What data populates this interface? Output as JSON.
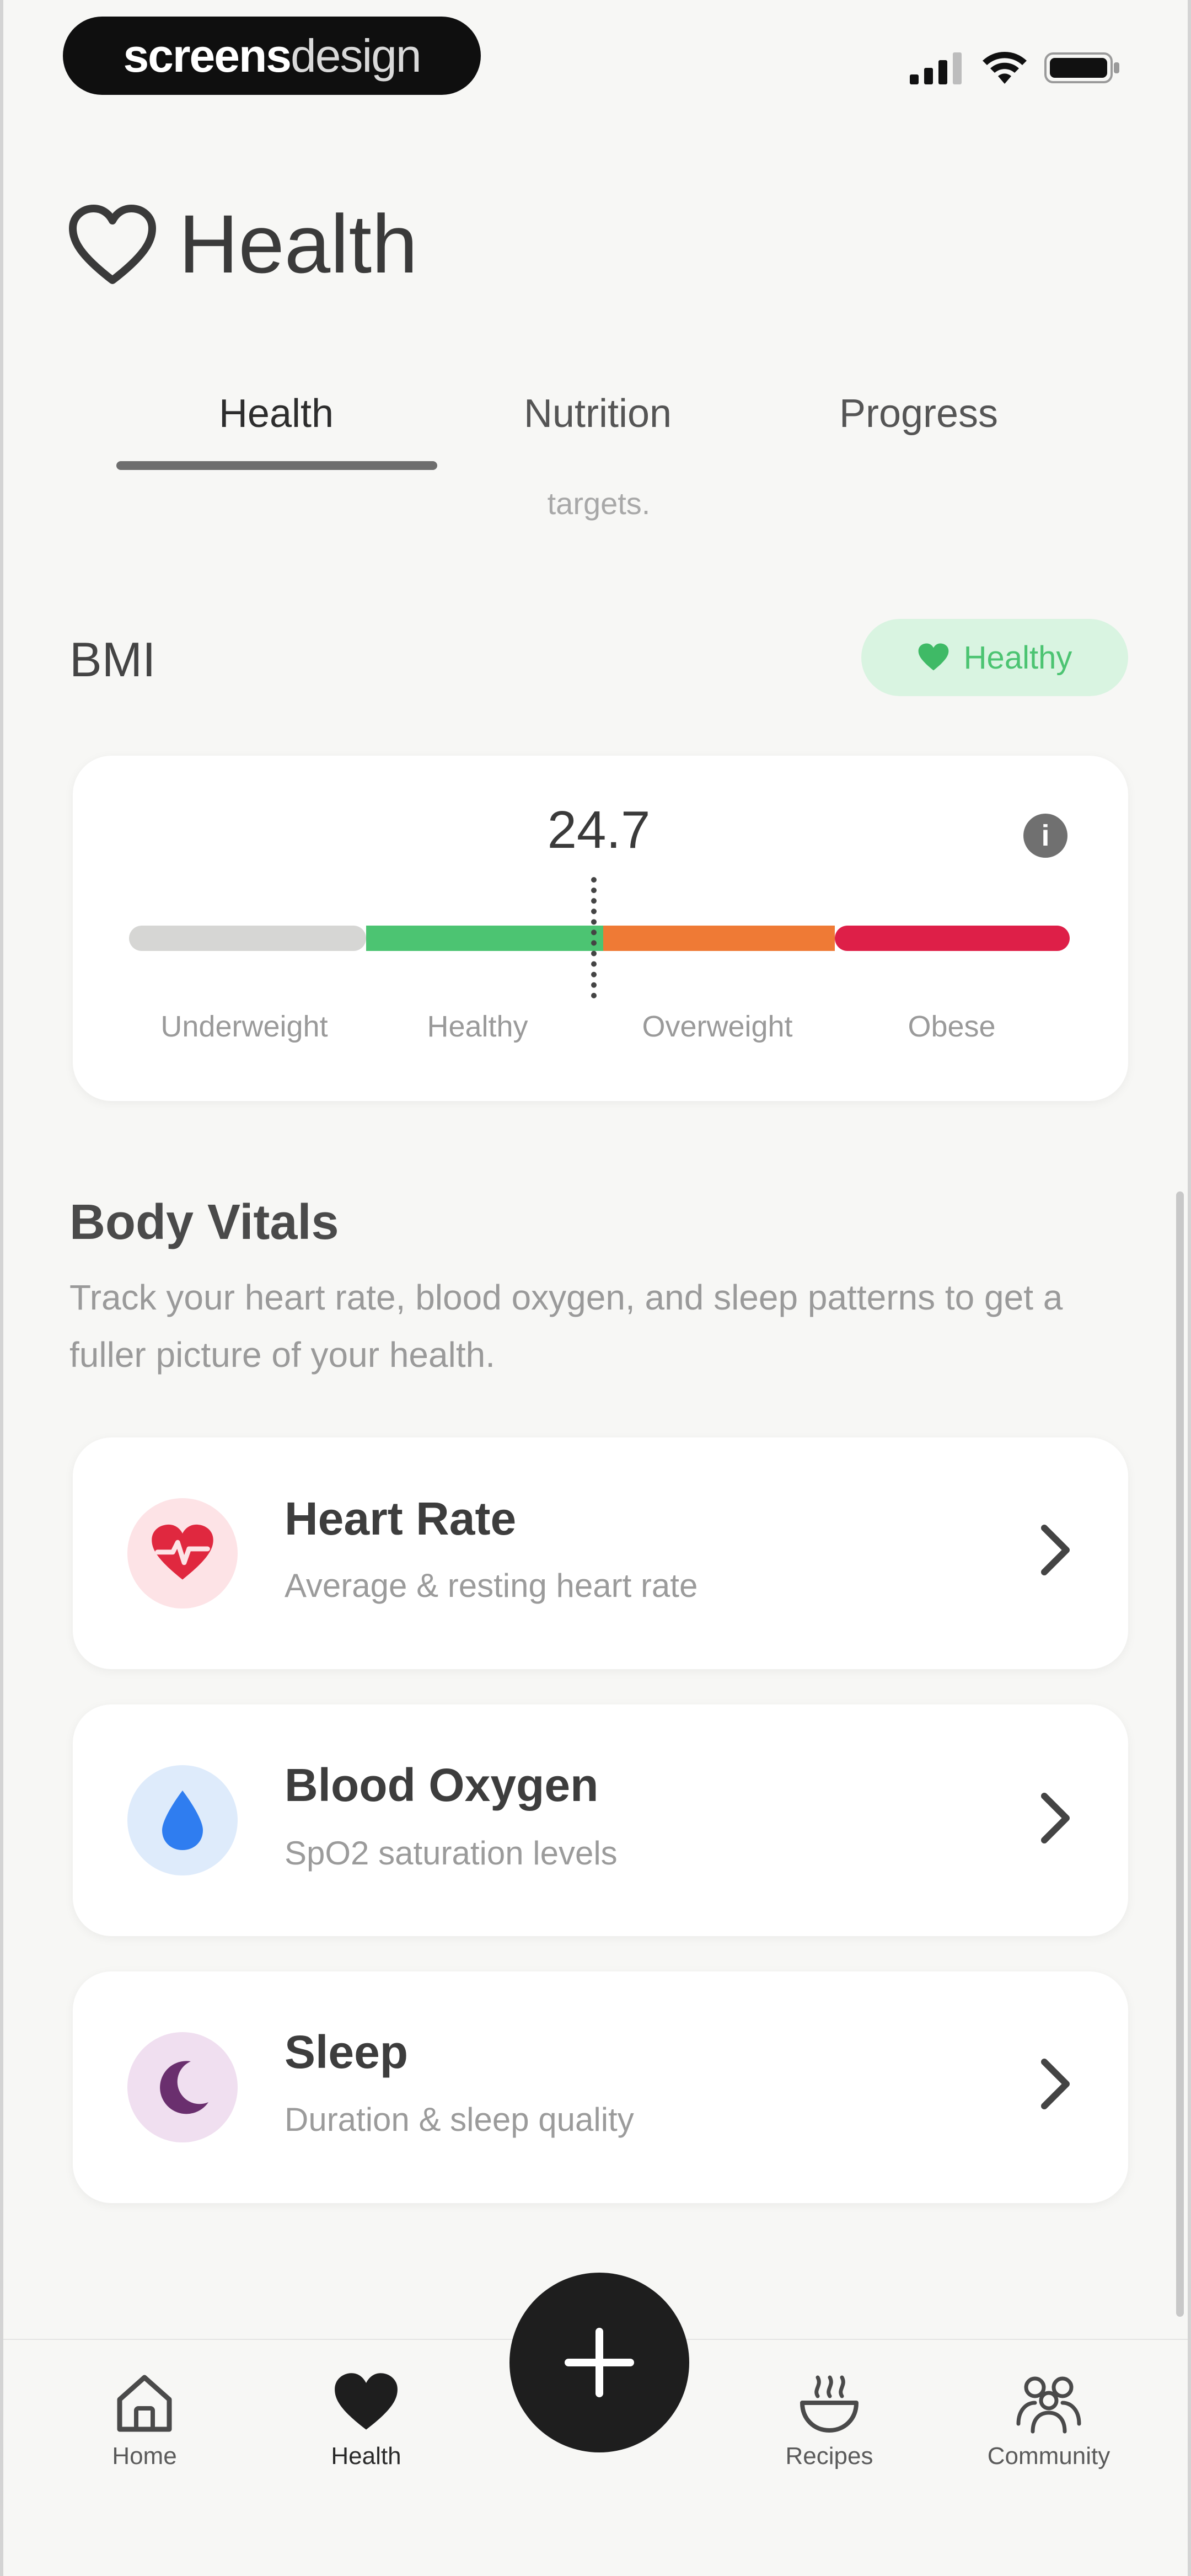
{
  "status_bar": {
    "brand_bold": "screens",
    "brand_light": "design"
  },
  "header": {
    "title": "Health"
  },
  "tabs": [
    {
      "label": "Health",
      "active": true
    },
    {
      "label": "Nutrition",
      "active": false
    },
    {
      "label": "Progress",
      "active": false
    }
  ],
  "clipped_text": "targets.",
  "bmi": {
    "title": "BMI",
    "badge": "Healthy",
    "value": "24.7",
    "categories": [
      "Underweight",
      "Healthy",
      "Overweight",
      "Obese"
    ],
    "colors": [
      "#d6d6d4",
      "#4cc472",
      "#ef7a35",
      "#de1f48"
    ],
    "info_icon": "info-icon"
  },
  "body_vitals": {
    "title": "Body Vitals",
    "description": "Track your heart rate, blood oxygen, and sleep patterns to get a fuller picture of your health.",
    "items": [
      {
        "name": "Heart Rate",
        "subtitle": "Average & resting heart rate",
        "icon": "heart-pulse-icon",
        "icon_color": "#e0283f",
        "icon_bg": "#fde3e6"
      },
      {
        "name": "Blood Oxygen",
        "subtitle": "SpO2 saturation levels",
        "icon": "water-drop-icon",
        "icon_color": "#2f7df0",
        "icon_bg": "#deebfb"
      },
      {
        "name": "Sleep",
        "subtitle": "Duration & sleep quality",
        "icon": "moon-icon",
        "icon_color": "#6a2f6e",
        "icon_bg": "#f0dff0"
      }
    ]
  },
  "bottom_nav": [
    {
      "label": "Home",
      "icon": "home-icon",
      "active": false
    },
    {
      "label": "Health",
      "icon": "heart-icon",
      "active": true
    },
    {
      "label": "Recipes",
      "icon": "recipes-icon",
      "active": false
    },
    {
      "label": "Community",
      "icon": "community-icon",
      "active": false
    }
  ],
  "fab_icon": "plus-icon"
}
